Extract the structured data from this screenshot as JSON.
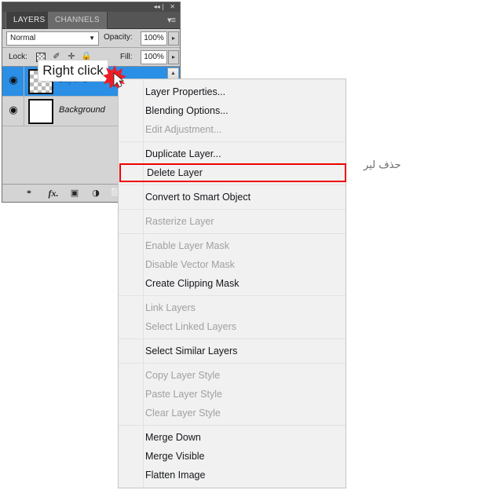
{
  "panel": {
    "titlebar": {
      "collapse_icon": "44",
      "close_icon": "✕"
    },
    "tabs": [
      {
        "label": "LAYERS",
        "active": true
      },
      {
        "label": "CHANNELS",
        "active": false
      }
    ],
    "panel_menu_icon": "▾≡",
    "blend": {
      "mode": "Normal",
      "caret": "▼",
      "opacity_label": "Opacity:",
      "opacity_value": "100%",
      "stepper": "▸"
    },
    "lock": {
      "label": "Lock:",
      "transparency_icon": "transparent-pixels",
      "image_icon": "✐",
      "position_icon": "✛",
      "all_icon": "🔒",
      "fill_label": "Fill:",
      "fill_value": "100%",
      "stepper": "▸"
    },
    "scroll_up": "▲",
    "layers": [
      {
        "name": "Layer 1",
        "visible_icon": "◉",
        "thumb": "transparent",
        "selected": true
      },
      {
        "name": "Background",
        "visible_icon": "◉",
        "thumb": "white",
        "selected": false
      }
    ],
    "footer": {
      "link_layers_icon": "⚭",
      "fx_icon": "fx.",
      "add_mask_icon": "▣",
      "adjustment_icon": "◑",
      "new_group_icon": "⬜"
    }
  },
  "tooltip": {
    "text": "Right click"
  },
  "context_menu": {
    "groups": [
      {
        "items": [
          {
            "label": "Layer Properties...",
            "state": "enabled"
          },
          {
            "label": "Blending Options...",
            "state": "enabled"
          },
          {
            "label": "Edit Adjustment...",
            "state": "disabled"
          }
        ]
      },
      {
        "items": [
          {
            "label": "Duplicate Layer...",
            "state": "enabled"
          },
          {
            "label": "Delete Layer",
            "state": "enabled",
            "highlight": true
          }
        ]
      },
      {
        "items": [
          {
            "label": "Convert to Smart Object",
            "state": "enabled"
          }
        ]
      },
      {
        "items": [
          {
            "label": "Rasterize Layer",
            "state": "disabled"
          }
        ]
      },
      {
        "items": [
          {
            "label": "Enable Layer Mask",
            "state": "disabled"
          },
          {
            "label": "Disable Vector Mask",
            "state": "disabled"
          },
          {
            "label": "Create Clipping Mask",
            "state": "enabled"
          }
        ]
      },
      {
        "items": [
          {
            "label": "Link Layers",
            "state": "disabled"
          },
          {
            "label": "Select Linked Layers",
            "state": "disabled"
          }
        ]
      },
      {
        "items": [
          {
            "label": "Select Similar Layers",
            "state": "enabled"
          }
        ]
      },
      {
        "items": [
          {
            "label": "Copy Layer Style",
            "state": "disabled"
          },
          {
            "label": "Paste Layer Style",
            "state": "disabled"
          },
          {
            "label": "Clear Layer Style",
            "state": "disabled"
          }
        ]
      },
      {
        "items": [
          {
            "label": "Merge Down",
            "state": "enabled"
          },
          {
            "label": "Merge Visible",
            "state": "enabled"
          },
          {
            "label": "Flatten Image",
            "state": "enabled"
          }
        ]
      }
    ]
  },
  "annotation": {
    "arabic_note": "حذف لير"
  },
  "colors": {
    "highlight_red": "#f00000",
    "selected_layer_blue": "#2a8fe5",
    "panel_gray": "#d4d4d4",
    "menu_gray": "#f1f1f1"
  }
}
